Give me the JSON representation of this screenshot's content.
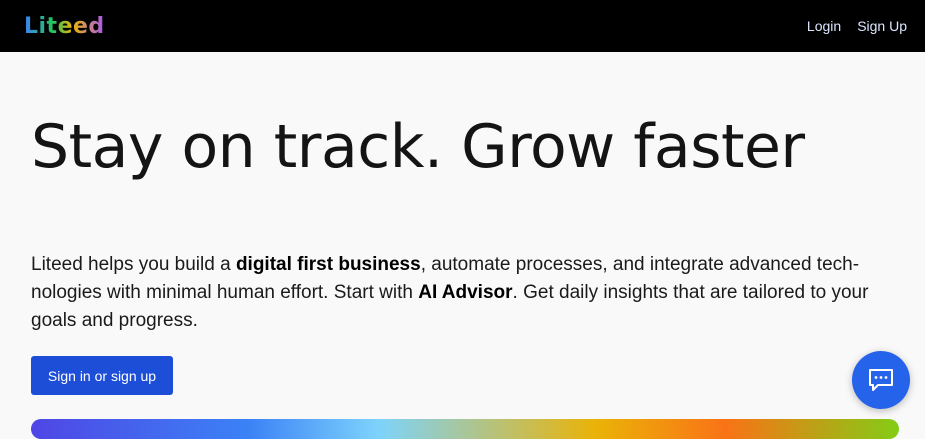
{
  "header": {
    "logo_text": "Liteed",
    "nav": [
      {
        "label": "Login"
      },
      {
        "label": "Sign Up"
      }
    ]
  },
  "hero": {
    "title": "Stay on track. Grow faster",
    "intro": {
      "part1": "Liteed helps you build a ",
      "bold1": "digital first business",
      "part2": ", automate processes, and integrate advanced tech-nologies with minimal human effort. Start with ",
      "bold2": "AI Advisor",
      "part3": ". Get daily insights that are tailored to your goals and progress."
    },
    "cta_label": "Sign in or sign up"
  },
  "chat": {
    "icon": "chat-bubble-icon"
  },
  "colors": {
    "header_bg": "#000000",
    "page_bg": "#f9f9f9",
    "primary": "#1d4ed8",
    "chat_fab": "#2563eb"
  }
}
